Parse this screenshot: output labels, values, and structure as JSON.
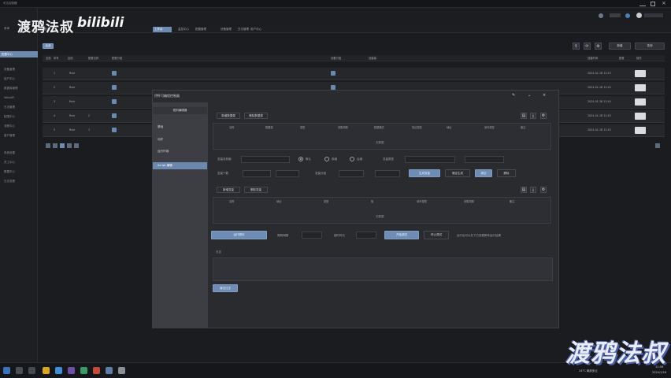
{
  "watermark": {
    "channel": "渡鸦法叔",
    "platform": "bilibili",
    "corner": "渡鸦法叔"
  },
  "titlebar": {
    "left_text": "可达控制器"
  },
  "sidebar": {
    "items": [
      "菜单",
      "配置中心",
      "设备管理",
      "用户中心",
      "数据库管理",
      "WebAPI",
      "日志管理",
      "权限中心",
      "流程中心",
      "客户管理",
      "系统设置",
      "员工中心",
      "数据中心",
      "日志查看"
    ],
    "active_index": 1
  },
  "tabs": {
    "items": [
      "首页",
      "工作台",
      "监控中心",
      "配置管理",
      "设备管理",
      "日志管理",
      "用户中心",
      "数据库管理"
    ],
    "active_index": 1
  },
  "toolbar": {
    "add_label": "新增",
    "search_label": "查询",
    "icons": [
      "filter-icon",
      "refresh-icon",
      "settings-icon"
    ]
  },
  "table": {
    "headers": [
      "全选",
      "序号",
      "启用",
      "配置名称",
      "配置分组",
      "设备分组",
      "创建者",
      "备注",
      "创建时间",
      "配置",
      "操作"
    ],
    "rows": [
      {
        "idx": "1",
        "name": "Rule",
        "group": "",
        "creator": "",
        "note": "",
        "time": "2024-01-18 11:43",
        "op": "配置"
      },
      {
        "idx": "2",
        "name": "Rule",
        "group": "",
        "creator": "",
        "note": "",
        "time": "2024-01-18 11:44",
        "op": "配置"
      },
      {
        "idx": "3",
        "name": "Rule",
        "group": "",
        "creator": "",
        "note": "",
        "time": "2024-01-18 11:44",
        "op": "配置"
      },
      {
        "idx": "4",
        "name": "Rule",
        "group": "2",
        "creator": "",
        "note": "",
        "time": "2024-01-18 11:45",
        "op": "配置"
      },
      {
        "idx": "5",
        "name": "Rule",
        "group": "1",
        "creator": "",
        "note": "",
        "time": "2024-01-18 11:45",
        "op": "配置"
      }
    ]
  },
  "dialog": {
    "title": "",
    "sidebar_title": "打开可编程控制器",
    "sidebar_header": "规则编辑器",
    "nav": [
      "基础",
      "动作",
      "运行环境",
      "Script 编辑"
    ],
    "nav_active_index": 3,
    "sec1": {
      "btn_add": "新增数据源",
      "btn_del": "删除数据源",
      "columns": [
        "",
        "名称",
        "数据源",
        "类型",
        "采集周期",
        "数据格式",
        "协议类型",
        "地址",
        "读写类型",
        "备注"
      ],
      "empty": "无数据"
    },
    "form": {
      "label_a": "变量名前缀",
      "placeholder_a": "",
      "radio_options": [
        "默认",
        "前缀",
        "后缀"
      ],
      "radio_checked": 0,
      "label_b": "变量类型",
      "placeholder_b": "",
      "label_c": "变量个数",
      "placeholder_c": "",
      "label_d": "变量分组",
      "placeholder_d": "",
      "label_e": "起始地址",
      "btn_gen": "生成变量",
      "btn_apply": "确定生成",
      "btn_clear": "清空",
      "btn_delete": "删除"
    },
    "sec2": {
      "btn_add": "新增变量",
      "btn_del": "删除变量",
      "columns": [
        "",
        "名称",
        "地址",
        "类型",
        "值",
        "读写权限",
        "采集周期",
        "备注"
      ],
      "empty": "无数据"
    },
    "script_row": {
      "btn_run": "运行脚本",
      "label_interval": "周期间隔",
      "interval_value": "",
      "label_timeout": "超时时长",
      "timeout_value": "",
      "btn_start": "开始调试",
      "btn_stop": "停止调试",
      "hint": "运行后可以在下方查看脚本运行结果"
    },
    "log_label": "日志",
    "btn_clear_log": "清空日志"
  },
  "taskbar": {
    "weather": "24°C 局部多云",
    "time": "11:56",
    "date": "2024/1/18"
  }
}
